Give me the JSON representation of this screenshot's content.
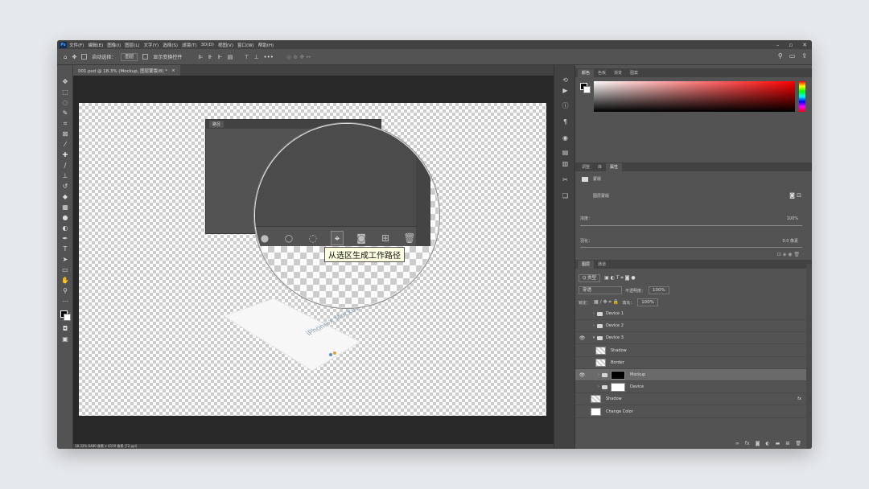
{
  "menu": [
    "文件(F)",
    "编辑(E)",
    "图像(I)",
    "图层(L)",
    "文字(Y)",
    "选择(S)",
    "滤镜(T)",
    "3D(D)",
    "视图(V)",
    "窗口(W)",
    "帮助(H)"
  ],
  "app_logo": "Ps",
  "options": {
    "auto_select_label": "自动选择：",
    "auto_select_value": "图层",
    "show_transform_label": "显示变换控件"
  },
  "document_tab": "001.psd @ 18.3% (Mockup, 图层蒙版/8) *",
  "path_panel": {
    "title": "路径",
    "tooltip": "从选区生成工作路径"
  },
  "mockup_text": "iPhone X Mockup",
  "status": "18.33%    6480 像素 x 4319 像素 (72 ppi)",
  "color_panel": {
    "tabs": [
      "颜色",
      "色板",
      "渐变",
      "图案"
    ]
  },
  "properties_panel": {
    "tabs": [
      "调整",
      "库",
      "属性"
    ],
    "section": "蒙版",
    "layer_mask_label": "图层蒙版",
    "density_label": "浓度：",
    "density_value": "100%",
    "feather_label": "羽化：",
    "feather_value": "0.0 像素"
  },
  "layers_panel": {
    "tabs": [
      "图层",
      "通道"
    ],
    "filter_label": "Q 类型",
    "blend_mode": "穿透",
    "opacity_label": "不透明度：",
    "opacity_value": "100%",
    "lock_label": "锁定：",
    "fill_label": "填充：",
    "fill_value": "100%",
    "layers": [
      {
        "name": "Device 1",
        "kind": "folder",
        "visible": false,
        "indent": 0
      },
      {
        "name": "Device 2",
        "kind": "folder",
        "visible": false,
        "indent": 0
      },
      {
        "name": "Device 3",
        "kind": "folder",
        "visible": true,
        "indent": 0,
        "open": true
      },
      {
        "name": "Shadow",
        "kind": "smart",
        "visible": false,
        "indent": 1
      },
      {
        "name": "Border",
        "kind": "smart",
        "visible": false,
        "indent": 1
      },
      {
        "name": "Mockup",
        "kind": "folder-mask",
        "visible": true,
        "indent": 1,
        "selected": true
      },
      {
        "name": "Device",
        "kind": "folder-mask",
        "visible": false,
        "indent": 1
      },
      {
        "name": "Shadow",
        "kind": "smart",
        "visible": false,
        "indent": 0,
        "fx": "fx"
      },
      {
        "name": "Change Color",
        "kind": "fill",
        "visible": false,
        "indent": 0
      }
    ]
  }
}
